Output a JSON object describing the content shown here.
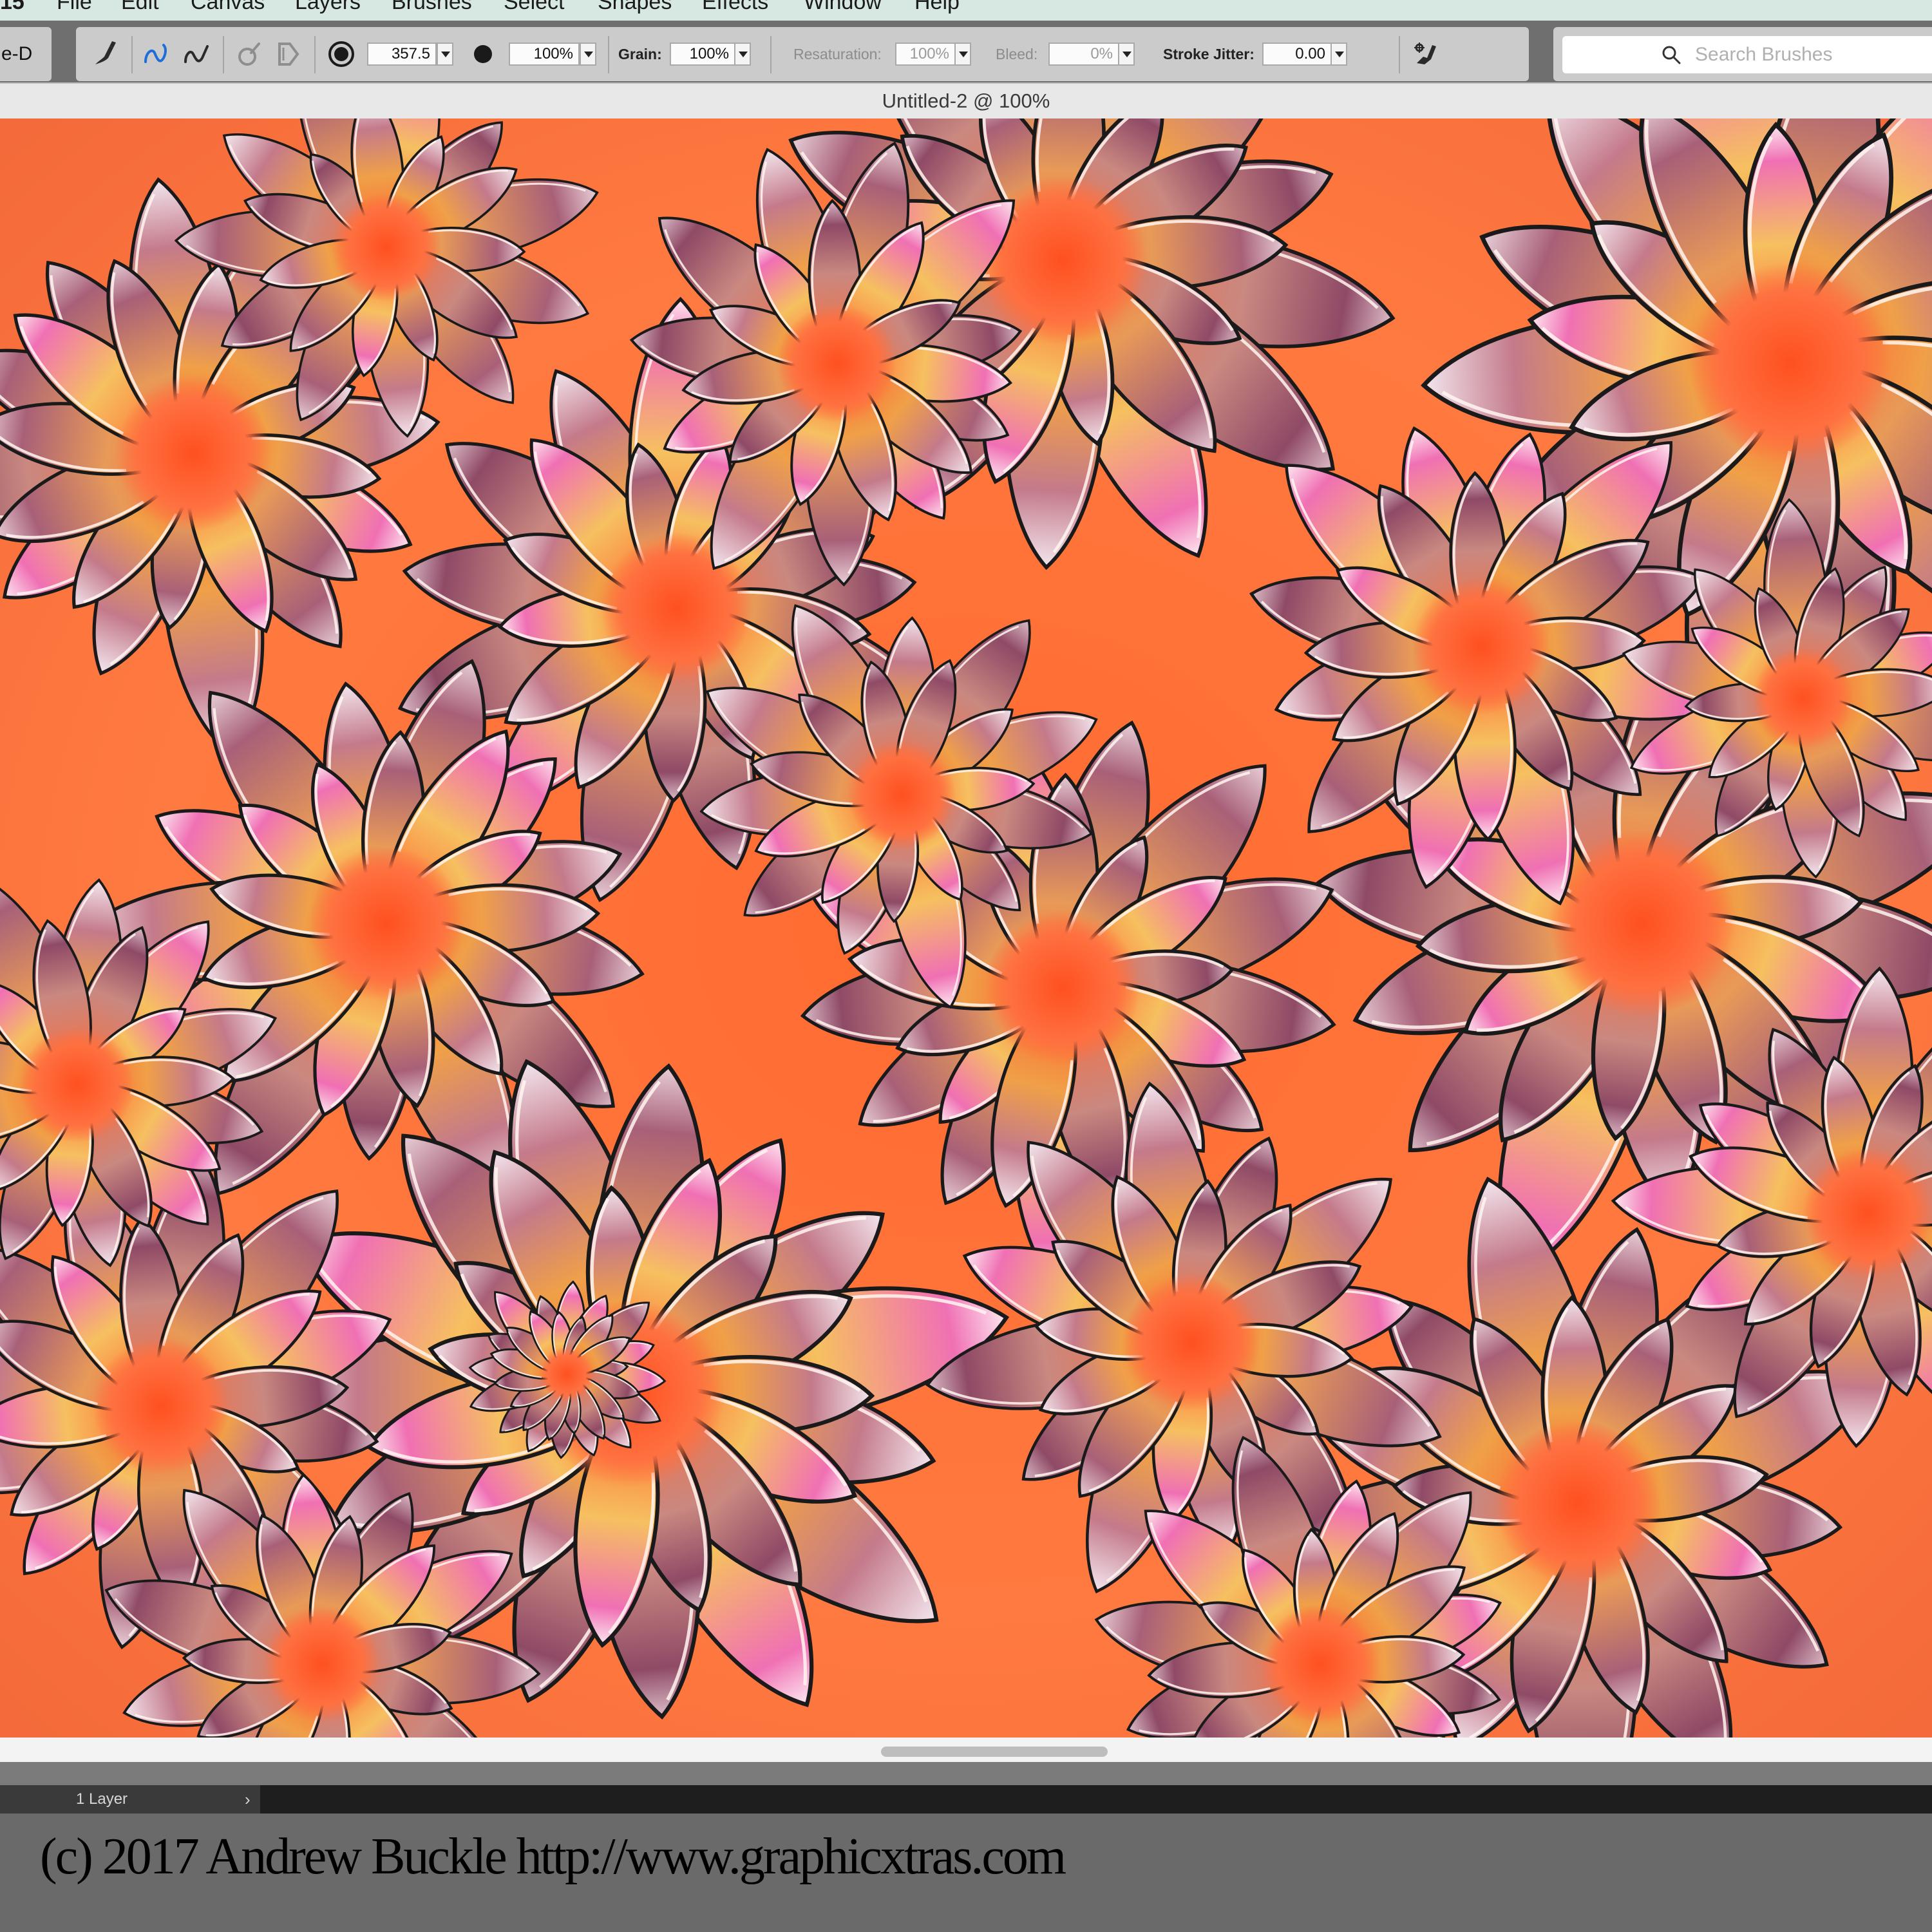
{
  "menubar": {
    "app_label": "15",
    "items": [
      "File",
      "Edit",
      "Canvas",
      "Layers",
      "Brushes",
      "Select",
      "Shapes",
      "Effects",
      "Window",
      "Help"
    ]
  },
  "propbar": {
    "mode_label": "e-D",
    "size_value": "357.5",
    "opacity_value": "100%",
    "grain_label": "Grain:",
    "grain_value": "100%",
    "resaturation_label": "Resaturation:",
    "resaturation_value": "100%",
    "bleed_label": "Bleed:",
    "bleed_value": "0%",
    "stroke_jitter_label": "Stroke Jitter:",
    "stroke_jitter_value": "0.00"
  },
  "search": {
    "placeholder": "Search Brushes"
  },
  "document": {
    "title": "Untitled-2 @ 100%"
  },
  "layers": {
    "count_label": "1 Layer"
  },
  "footer": {
    "copyright": "(c) 2017 Andrew Buckle http://www.graphicxtras.com"
  },
  "colors": {
    "menubar_bg": "#d7e7e2",
    "toolbar_bg": "#cbcbcb",
    "canvas_orange": "#ff6a30",
    "petal_mauve": "#b87088",
    "petal_gold": "#f0b048",
    "petal_pink": "#f070b8"
  },
  "icons": [
    "brush-tool-icon",
    "freehand-stroke-icon",
    "straight-stroke-icon",
    "dropper-icon",
    "brush-ghost-icon",
    "size-icon",
    "opacity-icon",
    "brush-settings-icon",
    "search-icon",
    "chevron-right-icon"
  ]
}
